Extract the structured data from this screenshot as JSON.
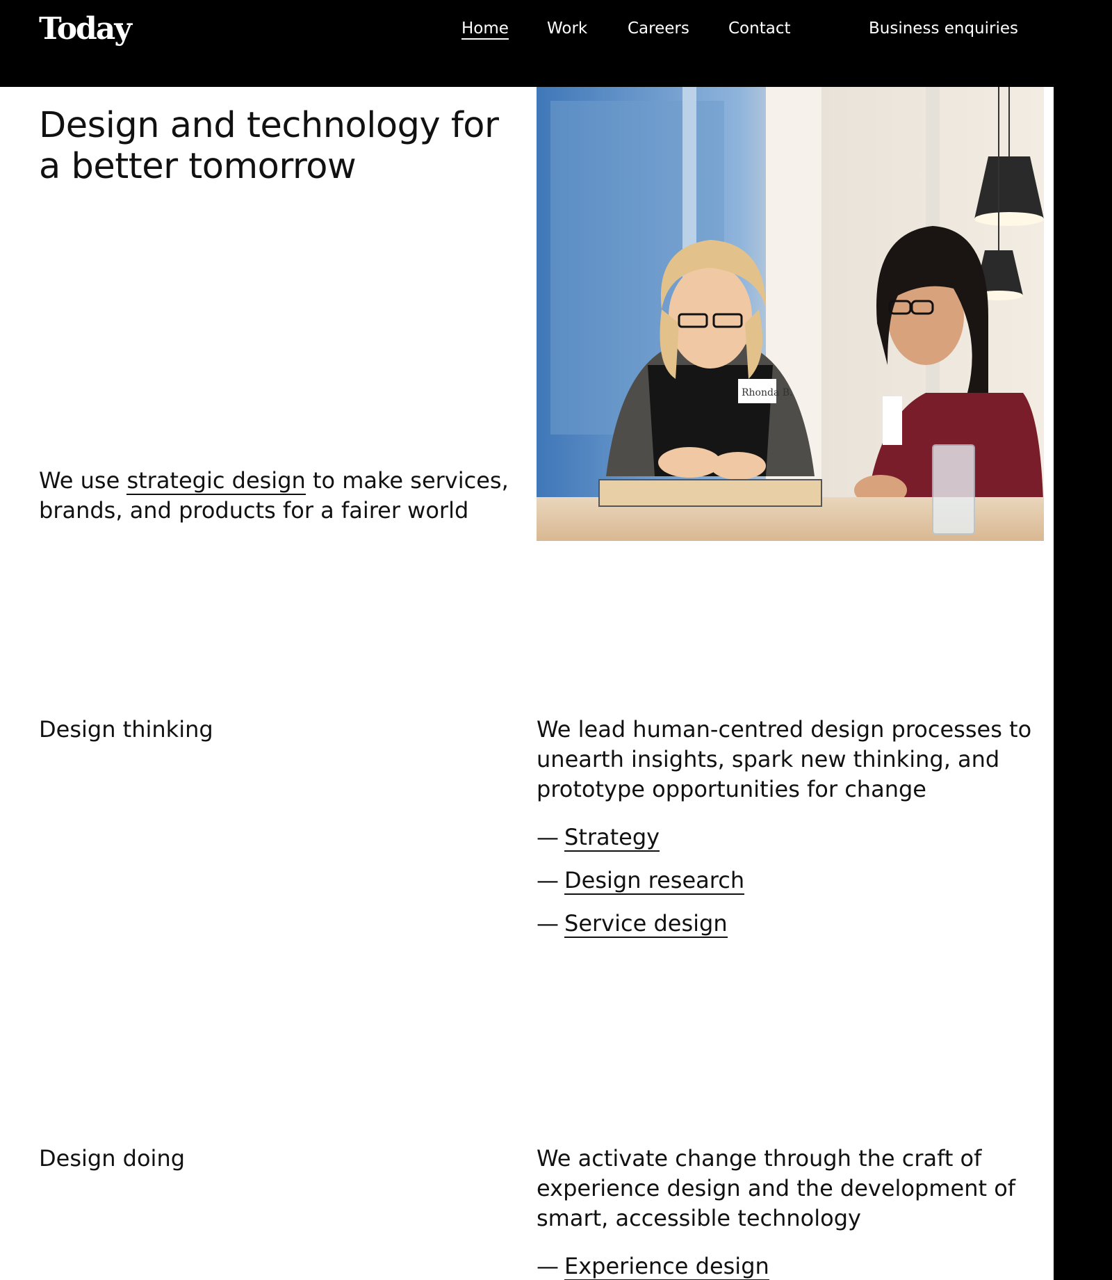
{
  "header": {
    "logo": "Today",
    "nav": {
      "home": "Home",
      "work": "Work",
      "careers": "Careers",
      "contact": "Contact"
    },
    "business_enquiries": "Business enquiries"
  },
  "hero": {
    "title": "Design and technology for a better tomorrow",
    "subtitle_before": "We use ",
    "subtitle_link": "strategic design",
    "subtitle_after": " to make services, brands, and products for a fairer world",
    "image_name_tag": "Rhonda B."
  },
  "sections": {
    "thinking": {
      "label": "Design thinking",
      "description": "We lead human-centred design processes to unearth insights, spark new thinking, and prototype opportunities for change",
      "dash": "—",
      "links": [
        "Strategy",
        "Design research",
        "Service design"
      ]
    },
    "doing": {
      "label": "Design doing",
      "description": "We activate change through the craft of experience design and the development of smart, accessible technology",
      "dash": "—",
      "links": [
        "Experience design"
      ]
    }
  },
  "colors": {
    "background": "#000000",
    "panel": "#ffffff",
    "text": "#111111"
  }
}
